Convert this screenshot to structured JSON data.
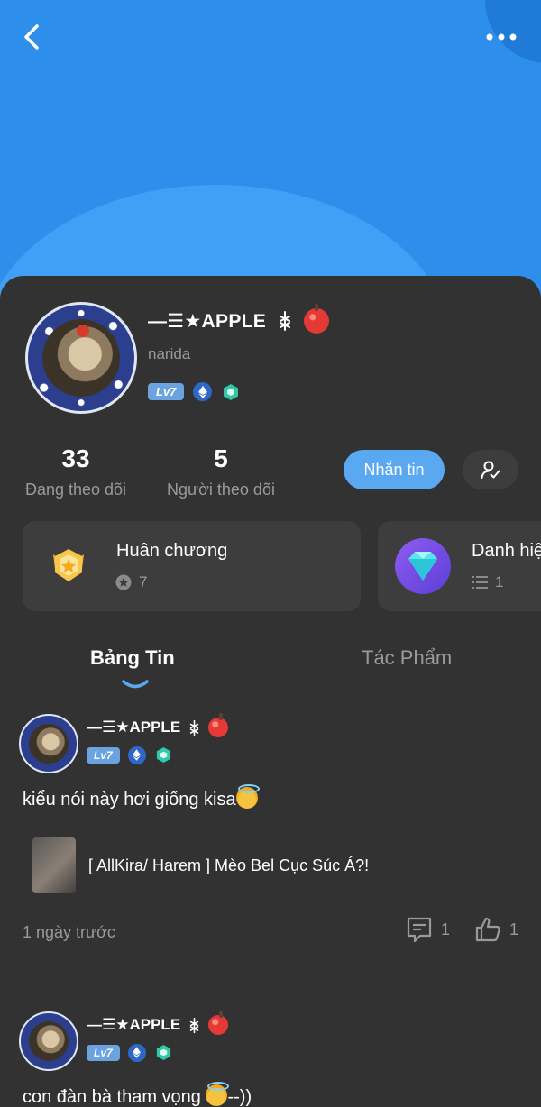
{
  "profile": {
    "display_name": "—☰★APPLE",
    "name_suffix_icon": "asterisk-glyph",
    "handle": "narida",
    "level": "Lv7"
  },
  "stats": {
    "following_count": "33",
    "following_label": "Đang theo dõi",
    "followers_count": "5",
    "followers_label": "Người theo dõi"
  },
  "actions": {
    "message_label": "Nhắn tin",
    "follow_icon": "user-check-icon"
  },
  "cards": [
    {
      "title": "Huân chương",
      "count": "7",
      "icon": "medal-icon"
    },
    {
      "title": "Danh hiệ",
      "count": "1",
      "icon": "diamond-icon"
    }
  ],
  "tabs": [
    {
      "label": "Bảng Tin",
      "active": true
    },
    {
      "label": "Tác Phẩm",
      "active": false
    }
  ],
  "posts": [
    {
      "author": "—☰★APPLE",
      "level": "Lv7",
      "text": "kiểu nói này hơi giống kisa",
      "linked_title": "[ AllKira/ Harem ] Mèo Bel Cục Súc Á?!",
      "time": "1 ngày trước",
      "comments": "1",
      "likes": "1"
    },
    {
      "author": "—☰★APPLE",
      "level": "Lv7",
      "text": "con đàn bà tham vọng",
      "text_suffix": "--))"
    }
  ],
  "colors": {
    "header_blue": "#2e8eec",
    "accent_blue": "#5aa8f0",
    "sheet_bg": "#323232",
    "card_bg": "#3d3d3d",
    "muted_text": "#9a9a9a"
  }
}
